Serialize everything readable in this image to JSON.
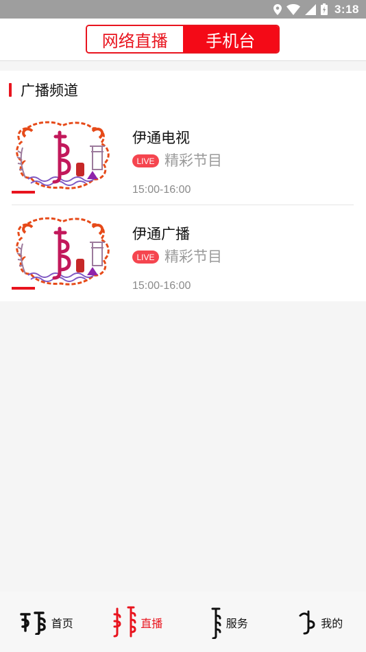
{
  "status_bar": {
    "time": "3:18",
    "icons": [
      "location-icon",
      "wifi-icon",
      "signal-icon",
      "battery-icon"
    ]
  },
  "header": {
    "tabs": [
      {
        "label": "网络直播",
        "active": false
      },
      {
        "label": "手机台",
        "active": true
      }
    ]
  },
  "section": {
    "title": "广播频道"
  },
  "channels": [
    {
      "name": "伊通电视",
      "badge": "LIVE",
      "program": "精彩节目",
      "time": "15:00-16:00"
    },
    {
      "name": "伊通广播",
      "badge": "LIVE",
      "program": "精彩节目",
      "time": "15:00-16:00"
    }
  ],
  "bottom_nav": {
    "items": [
      {
        "label": "首页",
        "icon": "mongolian-script-home-icon",
        "active": false
      },
      {
        "label": "直播",
        "icon": "mongolian-script-live-icon",
        "active": true
      },
      {
        "label": "服务",
        "icon": "mongolian-script-service-icon",
        "active": false
      },
      {
        "label": "我的",
        "icon": "mongolian-script-mine-icon",
        "active": false
      }
    ]
  },
  "colors": {
    "accent": "#e8141e",
    "status_bar": "#9e9e9e",
    "live_badge": "#f5454f",
    "muted_text": "#9a9a9a"
  }
}
